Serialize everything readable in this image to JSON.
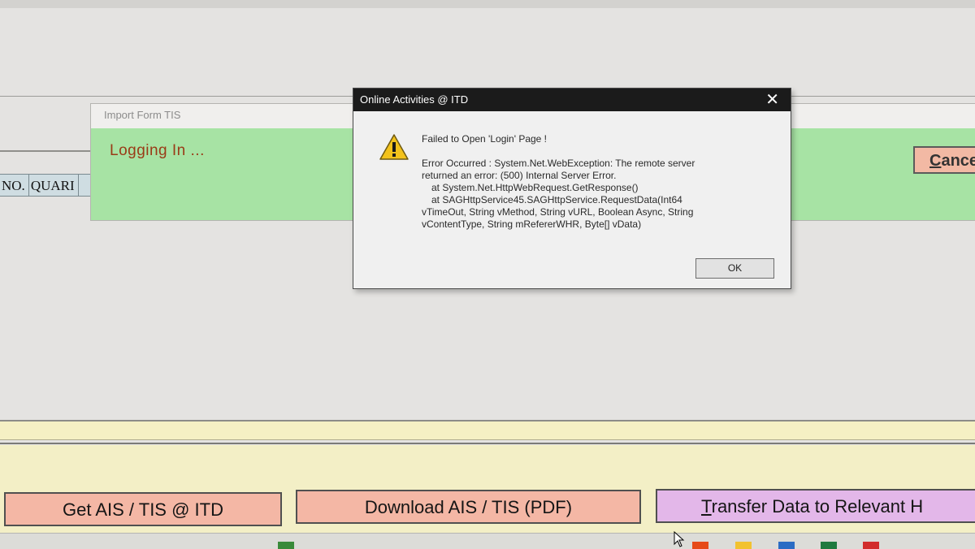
{
  "import_window": {
    "title": "Import Form TIS",
    "status": "Logging In ...",
    "cancel_label_first": "C",
    "cancel_label_rest": "ance"
  },
  "grid": {
    "columns": [
      "NO.",
      "QUARI"
    ]
  },
  "dialog": {
    "title": "Online Activities @ ITD",
    "close_glyph": "✕",
    "icon": "warning-icon",
    "message_lines": [
      "Failed to Open 'Login' Page !",
      "",
      "Error Occurred : System.Net.WebException: The remote server",
      "returned an error: (500) Internal Server Error.",
      "   at System.Net.HttpWebRequest.GetResponse()",
      "   at SAGHttpService45.SAGHttpService.RequestData(Int64",
      "vTimeOut, String vMethod, String vURL, Boolean Async, String",
      "vContentType, String mRefererWHR, Byte[] vData)"
    ],
    "ok_label": "OK"
  },
  "actions": {
    "get_label": "Get  AIS / TIS @ ITD",
    "download_label": "Download AIS / TIS (PDF)",
    "transfer_first": "T",
    "transfer_rest": "ransfer Data to Relevant H"
  },
  "colors": {
    "import_body": "#a7e3a4",
    "action_button": "#f4b7a5",
    "transfer_button": "#e3b7e9",
    "bottom_panel": "#f3efc6",
    "dialog_titlebar": "#1b1b1b"
  }
}
